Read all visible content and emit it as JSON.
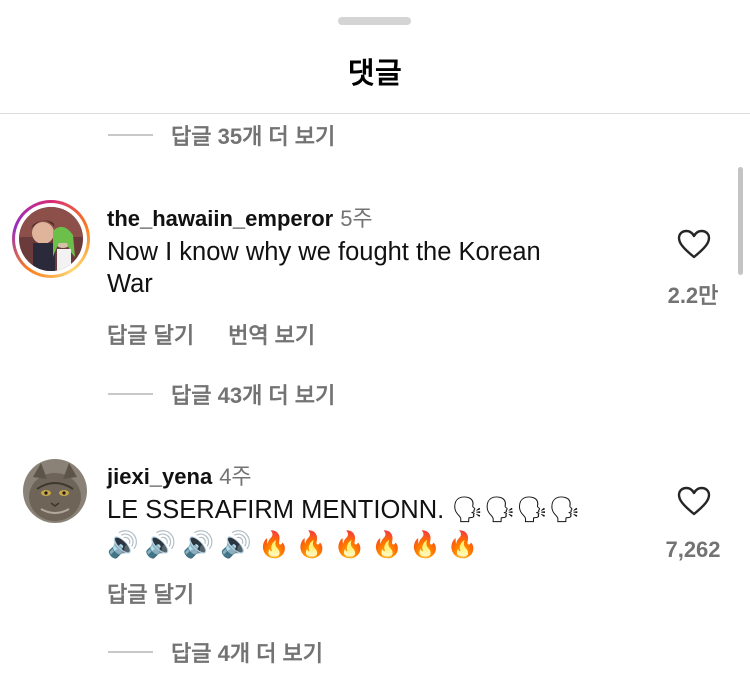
{
  "sheet": {
    "title": "댓글"
  },
  "comments": [
    {
      "replies_label": "답글 35개 더 보기"
    },
    {
      "username": "the_hawaiin_emperor",
      "time": "5주",
      "text_line1": "Now I know why we fought the Korean",
      "text_line2": "War",
      "reply_label": "답글 달기",
      "translate_label": "번역 보기",
      "likes": "2.2만",
      "replies_label": "답글 43개 더 보기"
    },
    {
      "username": "jiexi_yena",
      "time": "4주",
      "text_line1": "LE SSERAFIRM MENTIONN. 🗣🗣🗣🗣",
      "text_line2": "🔊🔊🔊🔊🔥🔥🔥🔥🔥🔥",
      "reply_label": "답글 달기",
      "likes": "7,262",
      "replies_label": "답글 4개 더 보기"
    }
  ],
  "colors": {
    "muted": "#737373",
    "ring_start": "#d62976",
    "ring_end": "#fa7e1e"
  },
  "icons": [
    "heart-icon",
    "avatar-image"
  ]
}
